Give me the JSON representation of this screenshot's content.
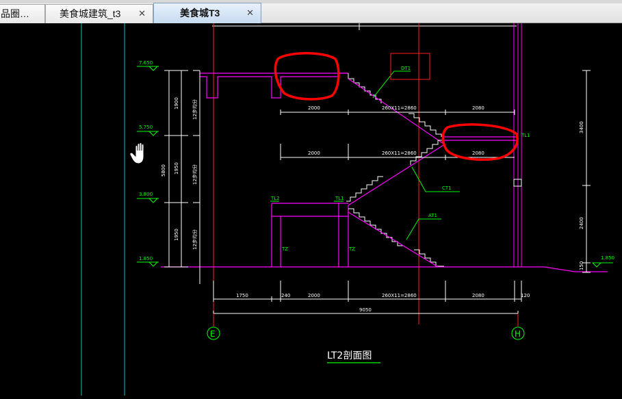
{
  "tabs": [
    {
      "label": "品圈…",
      "active": false
    },
    {
      "label": "美食城建筑_t3",
      "close": "✕",
      "active": false
    },
    {
      "label": "美食城T3",
      "close": "✕",
      "active": true
    }
  ],
  "drawing": {
    "elevations": [
      "7.650",
      "5.750",
      "3.800",
      "1.850",
      "1.850"
    ],
    "vertical_dims": [
      "1900",
      "1950",
      "1950",
      "5800"
    ],
    "step_labels": [
      "12步均分",
      "12步均分",
      "12步均分"
    ],
    "horizontal_dims_top": [
      "2000",
      "260X11=2860",
      "2080"
    ],
    "horizontal_dims_mid": [
      "2000",
      "260X11=2860",
      "2080"
    ],
    "horizontal_dims_bottom": [
      "1750",
      "240",
      "2000",
      "260X11=2860",
      "2080",
      "120"
    ],
    "total_dim": "9050",
    "right_dims": [
      "3400",
      "2400",
      "150"
    ],
    "member_labels": [
      "DT1",
      "TL1",
      "CT1",
      "TL2",
      "TL1",
      "AT1",
      "TZ",
      "TZ"
    ],
    "axes": [
      "E",
      "H"
    ],
    "title": "LT2剖面图"
  },
  "colors": {
    "background": "#000000",
    "geometry": "#ff00ff",
    "dimension": "#ffffff",
    "annotation": "#00ff00",
    "axis_line": "#ff0000",
    "grid_line": "#00c8c8",
    "highlight": "#ff0000"
  },
  "cursor": {
    "icon": "hand-grab-icon"
  }
}
